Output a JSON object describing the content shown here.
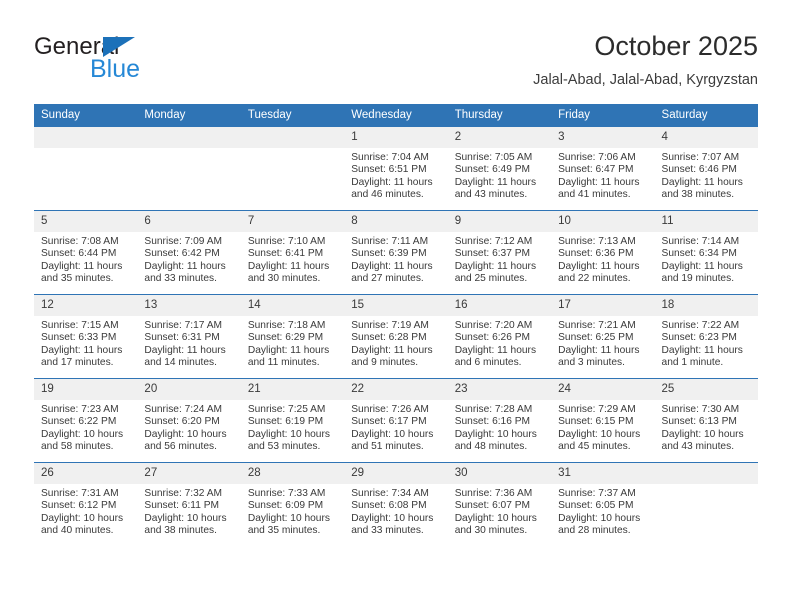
{
  "brand": {
    "name_top": "General",
    "name_bottom": "Blue",
    "triangle_icon": "triangle-icon",
    "color_dark": "#231f20",
    "color_blue": "#2688d6",
    "color_triangle": "#1c71b9"
  },
  "header": {
    "title": "October 2025",
    "subtitle": "Jalal-Abad, Jalal-Abad, Kyrgyzstan"
  },
  "theme": {
    "header_blue": "#2f74b5",
    "daynum_band": "#f0f0f0",
    "text": "#3a3a3a"
  },
  "calendar": {
    "weekday_headers": [
      "Sunday",
      "Monday",
      "Tuesday",
      "Wednesday",
      "Thursday",
      "Friday",
      "Saturday"
    ],
    "weeks": [
      [
        {
          "day": "",
          "empty": true,
          "sunrise": "",
          "sunset": "",
          "daylight_line1": "",
          "daylight_line2": ""
        },
        {
          "day": "",
          "empty": true,
          "sunrise": "",
          "sunset": "",
          "daylight_line1": "",
          "daylight_line2": ""
        },
        {
          "day": "",
          "empty": true,
          "sunrise": "",
          "sunset": "",
          "daylight_line1": "",
          "daylight_line2": ""
        },
        {
          "day": "1",
          "empty": false,
          "sunrise": "Sunrise: 7:04 AM",
          "sunset": "Sunset: 6:51 PM",
          "daylight_line1": "Daylight: 11 hours",
          "daylight_line2": "and 46 minutes."
        },
        {
          "day": "2",
          "empty": false,
          "sunrise": "Sunrise: 7:05 AM",
          "sunset": "Sunset: 6:49 PM",
          "daylight_line1": "Daylight: 11 hours",
          "daylight_line2": "and 43 minutes."
        },
        {
          "day": "3",
          "empty": false,
          "sunrise": "Sunrise: 7:06 AM",
          "sunset": "Sunset: 6:47 PM",
          "daylight_line1": "Daylight: 11 hours",
          "daylight_line2": "and 41 minutes."
        },
        {
          "day": "4",
          "empty": false,
          "sunrise": "Sunrise: 7:07 AM",
          "sunset": "Sunset: 6:46 PM",
          "daylight_line1": "Daylight: 11 hours",
          "daylight_line2": "and 38 minutes."
        }
      ],
      [
        {
          "day": "5",
          "empty": false,
          "sunrise": "Sunrise: 7:08 AM",
          "sunset": "Sunset: 6:44 PM",
          "daylight_line1": "Daylight: 11 hours",
          "daylight_line2": "and 35 minutes."
        },
        {
          "day": "6",
          "empty": false,
          "sunrise": "Sunrise: 7:09 AM",
          "sunset": "Sunset: 6:42 PM",
          "daylight_line1": "Daylight: 11 hours",
          "daylight_line2": "and 33 minutes."
        },
        {
          "day": "7",
          "empty": false,
          "sunrise": "Sunrise: 7:10 AM",
          "sunset": "Sunset: 6:41 PM",
          "daylight_line1": "Daylight: 11 hours",
          "daylight_line2": "and 30 minutes."
        },
        {
          "day": "8",
          "empty": false,
          "sunrise": "Sunrise: 7:11 AM",
          "sunset": "Sunset: 6:39 PM",
          "daylight_line1": "Daylight: 11 hours",
          "daylight_line2": "and 27 minutes."
        },
        {
          "day": "9",
          "empty": false,
          "sunrise": "Sunrise: 7:12 AM",
          "sunset": "Sunset: 6:37 PM",
          "daylight_line1": "Daylight: 11 hours",
          "daylight_line2": "and 25 minutes."
        },
        {
          "day": "10",
          "empty": false,
          "sunrise": "Sunrise: 7:13 AM",
          "sunset": "Sunset: 6:36 PM",
          "daylight_line1": "Daylight: 11 hours",
          "daylight_line2": "and 22 minutes."
        },
        {
          "day": "11",
          "empty": false,
          "sunrise": "Sunrise: 7:14 AM",
          "sunset": "Sunset: 6:34 PM",
          "daylight_line1": "Daylight: 11 hours",
          "daylight_line2": "and 19 minutes."
        }
      ],
      [
        {
          "day": "12",
          "empty": false,
          "sunrise": "Sunrise: 7:15 AM",
          "sunset": "Sunset: 6:33 PM",
          "daylight_line1": "Daylight: 11 hours",
          "daylight_line2": "and 17 minutes."
        },
        {
          "day": "13",
          "empty": false,
          "sunrise": "Sunrise: 7:17 AM",
          "sunset": "Sunset: 6:31 PM",
          "daylight_line1": "Daylight: 11 hours",
          "daylight_line2": "and 14 minutes."
        },
        {
          "day": "14",
          "empty": false,
          "sunrise": "Sunrise: 7:18 AM",
          "sunset": "Sunset: 6:29 PM",
          "daylight_line1": "Daylight: 11 hours",
          "daylight_line2": "and 11 minutes."
        },
        {
          "day": "15",
          "empty": false,
          "sunrise": "Sunrise: 7:19 AM",
          "sunset": "Sunset: 6:28 PM",
          "daylight_line1": "Daylight: 11 hours",
          "daylight_line2": "and 9 minutes."
        },
        {
          "day": "16",
          "empty": false,
          "sunrise": "Sunrise: 7:20 AM",
          "sunset": "Sunset: 6:26 PM",
          "daylight_line1": "Daylight: 11 hours",
          "daylight_line2": "and 6 minutes."
        },
        {
          "day": "17",
          "empty": false,
          "sunrise": "Sunrise: 7:21 AM",
          "sunset": "Sunset: 6:25 PM",
          "daylight_line1": "Daylight: 11 hours",
          "daylight_line2": "and 3 minutes."
        },
        {
          "day": "18",
          "empty": false,
          "sunrise": "Sunrise: 7:22 AM",
          "sunset": "Sunset: 6:23 PM",
          "daylight_line1": "Daylight: 11 hours",
          "daylight_line2": "and 1 minute."
        }
      ],
      [
        {
          "day": "19",
          "empty": false,
          "sunrise": "Sunrise: 7:23 AM",
          "sunset": "Sunset: 6:22 PM",
          "daylight_line1": "Daylight: 10 hours",
          "daylight_line2": "and 58 minutes."
        },
        {
          "day": "20",
          "empty": false,
          "sunrise": "Sunrise: 7:24 AM",
          "sunset": "Sunset: 6:20 PM",
          "daylight_line1": "Daylight: 10 hours",
          "daylight_line2": "and 56 minutes."
        },
        {
          "day": "21",
          "empty": false,
          "sunrise": "Sunrise: 7:25 AM",
          "sunset": "Sunset: 6:19 PM",
          "daylight_line1": "Daylight: 10 hours",
          "daylight_line2": "and 53 minutes."
        },
        {
          "day": "22",
          "empty": false,
          "sunrise": "Sunrise: 7:26 AM",
          "sunset": "Sunset: 6:17 PM",
          "daylight_line1": "Daylight: 10 hours",
          "daylight_line2": "and 51 minutes."
        },
        {
          "day": "23",
          "empty": false,
          "sunrise": "Sunrise: 7:28 AM",
          "sunset": "Sunset: 6:16 PM",
          "daylight_line1": "Daylight: 10 hours",
          "daylight_line2": "and 48 minutes."
        },
        {
          "day": "24",
          "empty": false,
          "sunrise": "Sunrise: 7:29 AM",
          "sunset": "Sunset: 6:15 PM",
          "daylight_line1": "Daylight: 10 hours",
          "daylight_line2": "and 45 minutes."
        },
        {
          "day": "25",
          "empty": false,
          "sunrise": "Sunrise: 7:30 AM",
          "sunset": "Sunset: 6:13 PM",
          "daylight_line1": "Daylight: 10 hours",
          "daylight_line2": "and 43 minutes."
        }
      ],
      [
        {
          "day": "26",
          "empty": false,
          "sunrise": "Sunrise: 7:31 AM",
          "sunset": "Sunset: 6:12 PM",
          "daylight_line1": "Daylight: 10 hours",
          "daylight_line2": "and 40 minutes."
        },
        {
          "day": "27",
          "empty": false,
          "sunrise": "Sunrise: 7:32 AM",
          "sunset": "Sunset: 6:11 PM",
          "daylight_line1": "Daylight: 10 hours",
          "daylight_line2": "and 38 minutes."
        },
        {
          "day": "28",
          "empty": false,
          "sunrise": "Sunrise: 7:33 AM",
          "sunset": "Sunset: 6:09 PM",
          "daylight_line1": "Daylight: 10 hours",
          "daylight_line2": "and 35 minutes."
        },
        {
          "day": "29",
          "empty": false,
          "sunrise": "Sunrise: 7:34 AM",
          "sunset": "Sunset: 6:08 PM",
          "daylight_line1": "Daylight: 10 hours",
          "daylight_line2": "and 33 minutes."
        },
        {
          "day": "30",
          "empty": false,
          "sunrise": "Sunrise: 7:36 AM",
          "sunset": "Sunset: 6:07 PM",
          "daylight_line1": "Daylight: 10 hours",
          "daylight_line2": "and 30 minutes."
        },
        {
          "day": "31",
          "empty": false,
          "sunrise": "Sunrise: 7:37 AM",
          "sunset": "Sunset: 6:05 PM",
          "daylight_line1": "Daylight: 10 hours",
          "daylight_line2": "and 28 minutes."
        },
        {
          "day": "",
          "empty": true,
          "sunrise": "",
          "sunset": "",
          "daylight_line1": "",
          "daylight_line2": ""
        }
      ]
    ]
  }
}
